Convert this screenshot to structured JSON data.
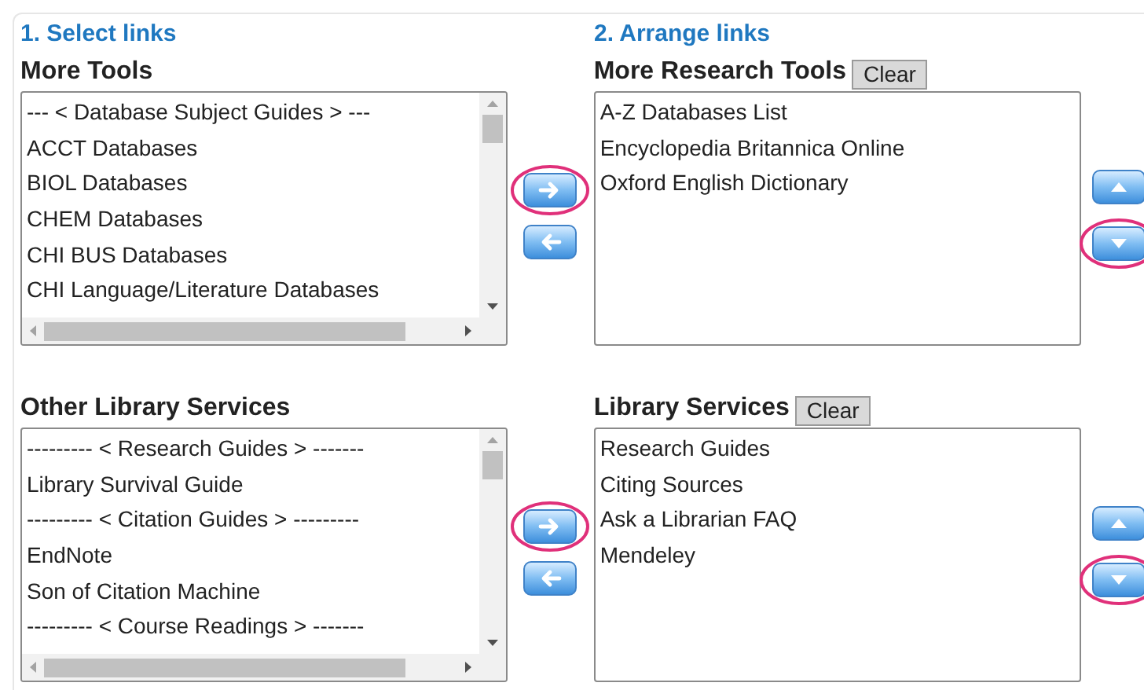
{
  "headings": [
    "1. Select links",
    "2. Arrange links"
  ],
  "groups": [
    {
      "source": {
        "title": "More Tools",
        "items": [
          "--- < Database Subject Guides > ---",
          "ACCT Databases",
          "BIOL Databases",
          "CHEM Databases",
          "CHI BUS Databases",
          "CHI Language/Literature Databases"
        ]
      },
      "move_buttons": [
        {
          "kind": "right",
          "circled": true
        },
        {
          "kind": "left",
          "circled": false
        }
      ],
      "target": {
        "title": "More Research Tools",
        "clear_button": "Clear",
        "items": [
          "A-Z Databases List",
          "Encyclopedia Britannica Online",
          "Oxford English Dictionary"
        ]
      },
      "order_buttons": [
        {
          "kind": "up",
          "circled": false
        },
        {
          "kind": "down",
          "circled": true
        }
      ]
    },
    {
      "source": {
        "title": "Other Library Services",
        "items": [
          "--------- < Research Guides > -------",
          "Library Survival Guide",
          "--------- < Citation Guides > ---------",
          "EndNote",
          "Son of Citation Machine",
          "--------- < Course Readings > -------"
        ]
      },
      "move_buttons": [
        {
          "kind": "right",
          "circled": true
        },
        {
          "kind": "left",
          "circled": false
        }
      ],
      "target": {
        "title": "Library Services",
        "clear_button": "Clear",
        "items": [
          "Research Guides",
          "Citing Sources",
          "Ask a Librarian FAQ",
          "Mendeley"
        ]
      },
      "order_buttons": [
        {
          "kind": "up",
          "circled": false
        },
        {
          "kind": "down",
          "circled": true
        }
      ]
    }
  ]
}
